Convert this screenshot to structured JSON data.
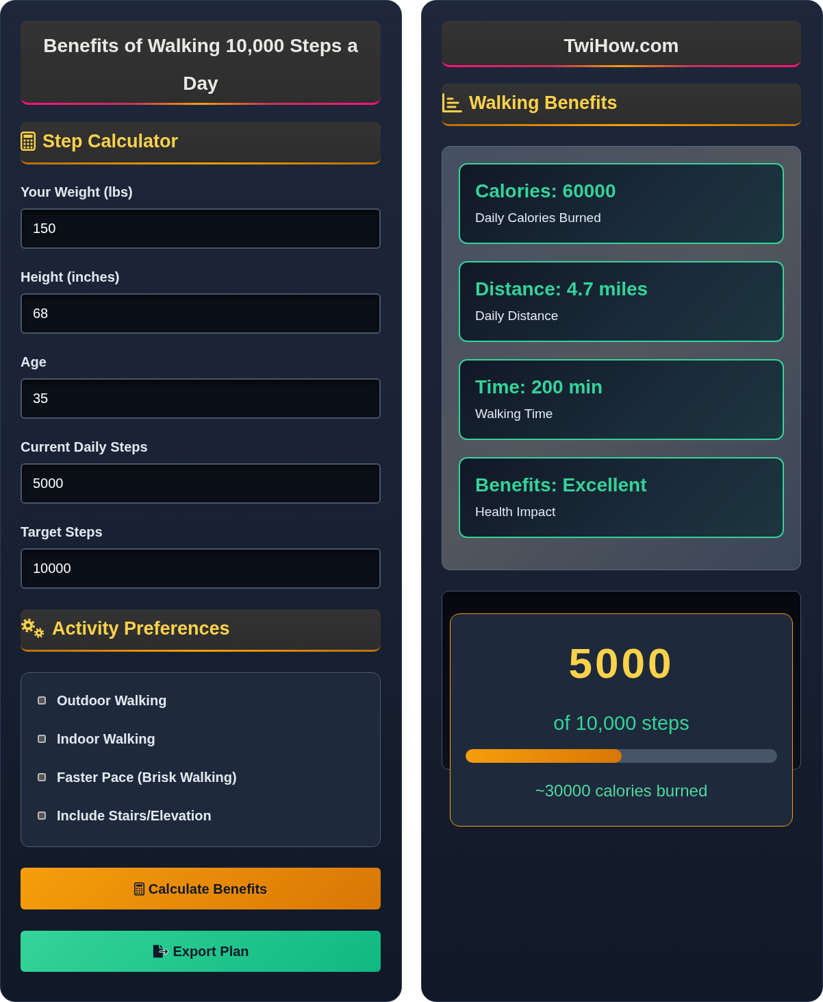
{
  "form_panel": {
    "title": "Benefits of Walking 10,000 Steps a Day",
    "calculator": {
      "heading": "Step Calculator",
      "fields": [
        {
          "label": "Your Weight (lbs)",
          "value": "150"
        },
        {
          "label": "Height (inches)",
          "value": "68"
        },
        {
          "label": "Age",
          "value": "35"
        },
        {
          "label": "Current Daily Steps",
          "value": "5000"
        },
        {
          "label": "Target Steps",
          "value": "10000"
        }
      ]
    },
    "preferences": {
      "heading": "Activity Preferences",
      "options": [
        {
          "label": "Outdoor Walking",
          "checked": false
        },
        {
          "label": "Indoor Walking",
          "checked": false
        },
        {
          "label": "Faster Pace (Brisk Walking)",
          "checked": false
        },
        {
          "label": "Include Stairs/Elevation",
          "checked": false
        }
      ]
    },
    "buttons": [
      {
        "kind": "calculate",
        "label": "Calculate Benefits"
      },
      {
        "kind": "export",
        "label": "Export Plan"
      }
    ]
  },
  "results_panel": {
    "site_title": "TwiHow.com",
    "heading": "Walking Benefits",
    "results": [
      {
        "title": "Calories: 60000",
        "subtitle": "Daily Calories Burned"
      },
      {
        "title": "Distance: 4.7 miles",
        "subtitle": "Daily Distance"
      },
      {
        "title": "Time: 200 min",
        "subtitle": "Walking Time"
      },
      {
        "title": "Benefits: Excellent",
        "subtitle": "Health Impact"
      }
    ],
    "progress": {
      "steps": "5000",
      "goal": "of 10,000 steps",
      "level": 0.5,
      "calories": "~30000 calories burned"
    }
  }
}
